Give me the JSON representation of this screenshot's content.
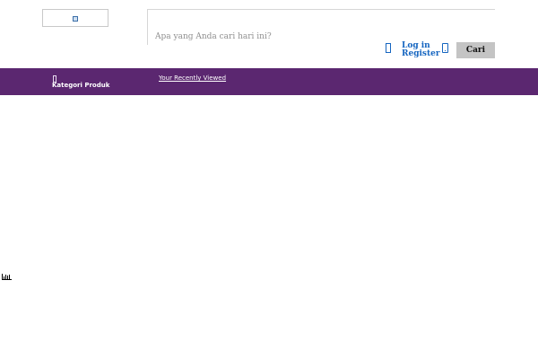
{
  "header": {
    "logo": {
      "alt_icon": "broken-image-icon"
    },
    "search": {
      "placeholder": "Apa yang Anda cari hari ini?",
      "value": "",
      "button_label": "Cari"
    },
    "account": {
      "icon": "user-icon",
      "login_label": "Log in",
      "register_label": "Register"
    },
    "contact": {
      "icon": "phone-icon"
    }
  },
  "nav": {
    "menu_icon": "hamburger-icon",
    "category_label": "Kategori Produk",
    "recent_label": "Your Recently Viewed"
  },
  "floating": {
    "icon": "chart-icon"
  },
  "colors": {
    "nav_background": "#5b2770",
    "link": "#1565c0",
    "button_background": "#c4c4c4"
  }
}
